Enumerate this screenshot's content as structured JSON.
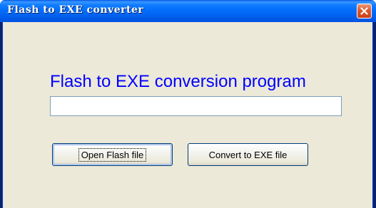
{
  "window": {
    "title": "Flash to EXE converter"
  },
  "main": {
    "heading": "Flash to EXE conversion program",
    "path_field": {
      "value": "",
      "placeholder": ""
    },
    "buttons": {
      "open_label": "Open Flash file",
      "convert_label": "Convert to EXE file"
    }
  },
  "icons": {
    "close": "close-icon"
  },
  "colors": {
    "titlebar": "#0054e3",
    "heading_text": "#0000ff",
    "client_background": "#ece9d8",
    "close_button": "#e0562b"
  }
}
